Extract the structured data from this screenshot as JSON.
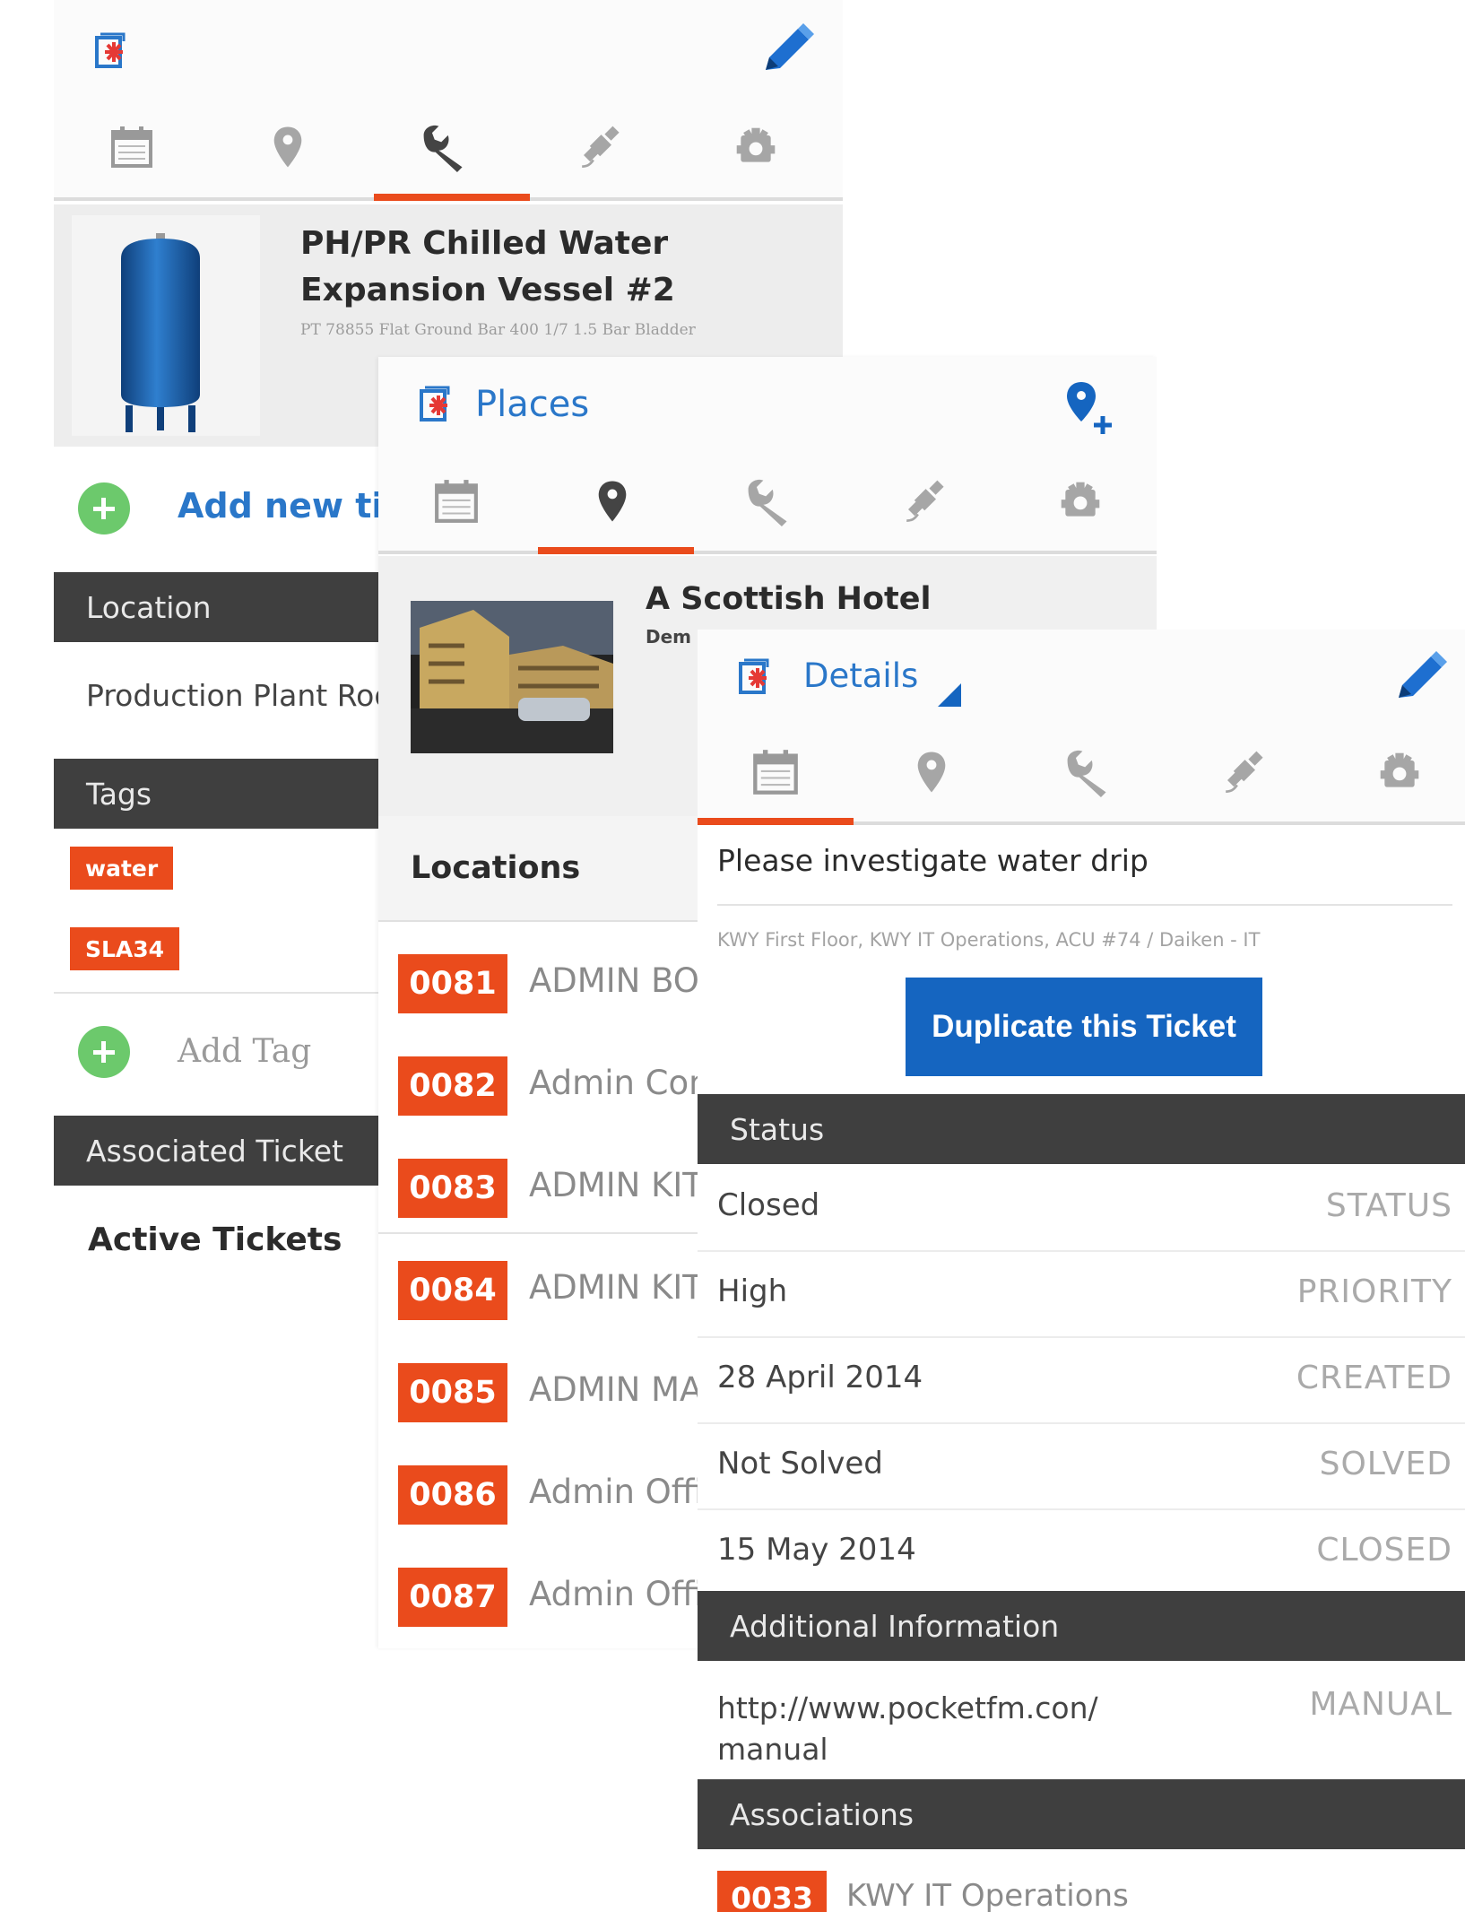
{
  "colors": {
    "accent": "#ea4b1c",
    "blue": "#1565c0",
    "section": "#3f3f3f",
    "tag_plus": "#6cc96c"
  },
  "icons": {
    "app": "pocketfm-app-icon",
    "edit": "pencil-icon",
    "add_place": "add-location-icon",
    "tabs": [
      "calendar-icon",
      "map-pin-icon",
      "wrench-icon",
      "satellite-icon",
      "gear-icon"
    ]
  },
  "asset_screen": {
    "asset_title": "PH/PR Chilled Water Expansion Vessel #2",
    "asset_subtitle": "PT 78855 Flat Ground Bar 400 1/7 1.5 Bar Bladder",
    "add_ticket": "Add new tick",
    "location_header": "Location",
    "location_value": "Production Plant Roo",
    "tags_header": "Tags",
    "tags": [
      "water",
      "SLA34"
    ],
    "add_tag": "Add Tag",
    "assoc_header": "Associated Ticket",
    "active_tickets": "Active Tickets"
  },
  "places_screen": {
    "title": "Places",
    "place_name": "A Scottish Hotel",
    "place_sub": "Dem",
    "locations_header": "Locations",
    "locations": [
      {
        "num": "0081",
        "name": "ADMIN BO"
      },
      {
        "num": "0082",
        "name": "Admin Con"
      },
      {
        "num": "0083",
        "name": "ADMIN KIT"
      },
      {
        "num": "0084",
        "name": "ADMIN KIT"
      },
      {
        "num": "0085",
        "name": "ADMIN MA"
      },
      {
        "num": "0086",
        "name": "Admin Offi"
      },
      {
        "num": "0087",
        "name": "Admin Offi"
      }
    ]
  },
  "details_screen": {
    "title": "Details",
    "ticket_title": "Please investigate water drip",
    "ticket_location": "KWY First Floor, KWY IT Operations, ACU #74 / Daiken - IT",
    "duplicate_button": "Duplicate this Ticket",
    "status_header": "Status",
    "status_rows": [
      {
        "value": "Closed",
        "key": "STATUS"
      },
      {
        "value": "High",
        "key": "PRIORITY"
      },
      {
        "value": "28 April 2014",
        "key": "CREATED"
      },
      {
        "value": "Not Solved",
        "key": "SOLVED"
      },
      {
        "value": "15 May 2014",
        "key": "CLOSED"
      }
    ],
    "additional_header": "Additional Information",
    "manual_url_line1": "http://www.pocketfm.con/",
    "manual_url_line2": "manual",
    "manual_key": "MANUAL",
    "associations_header": "Associations",
    "association": {
      "num": "0033",
      "name": "KWY IT Operations"
    }
  }
}
